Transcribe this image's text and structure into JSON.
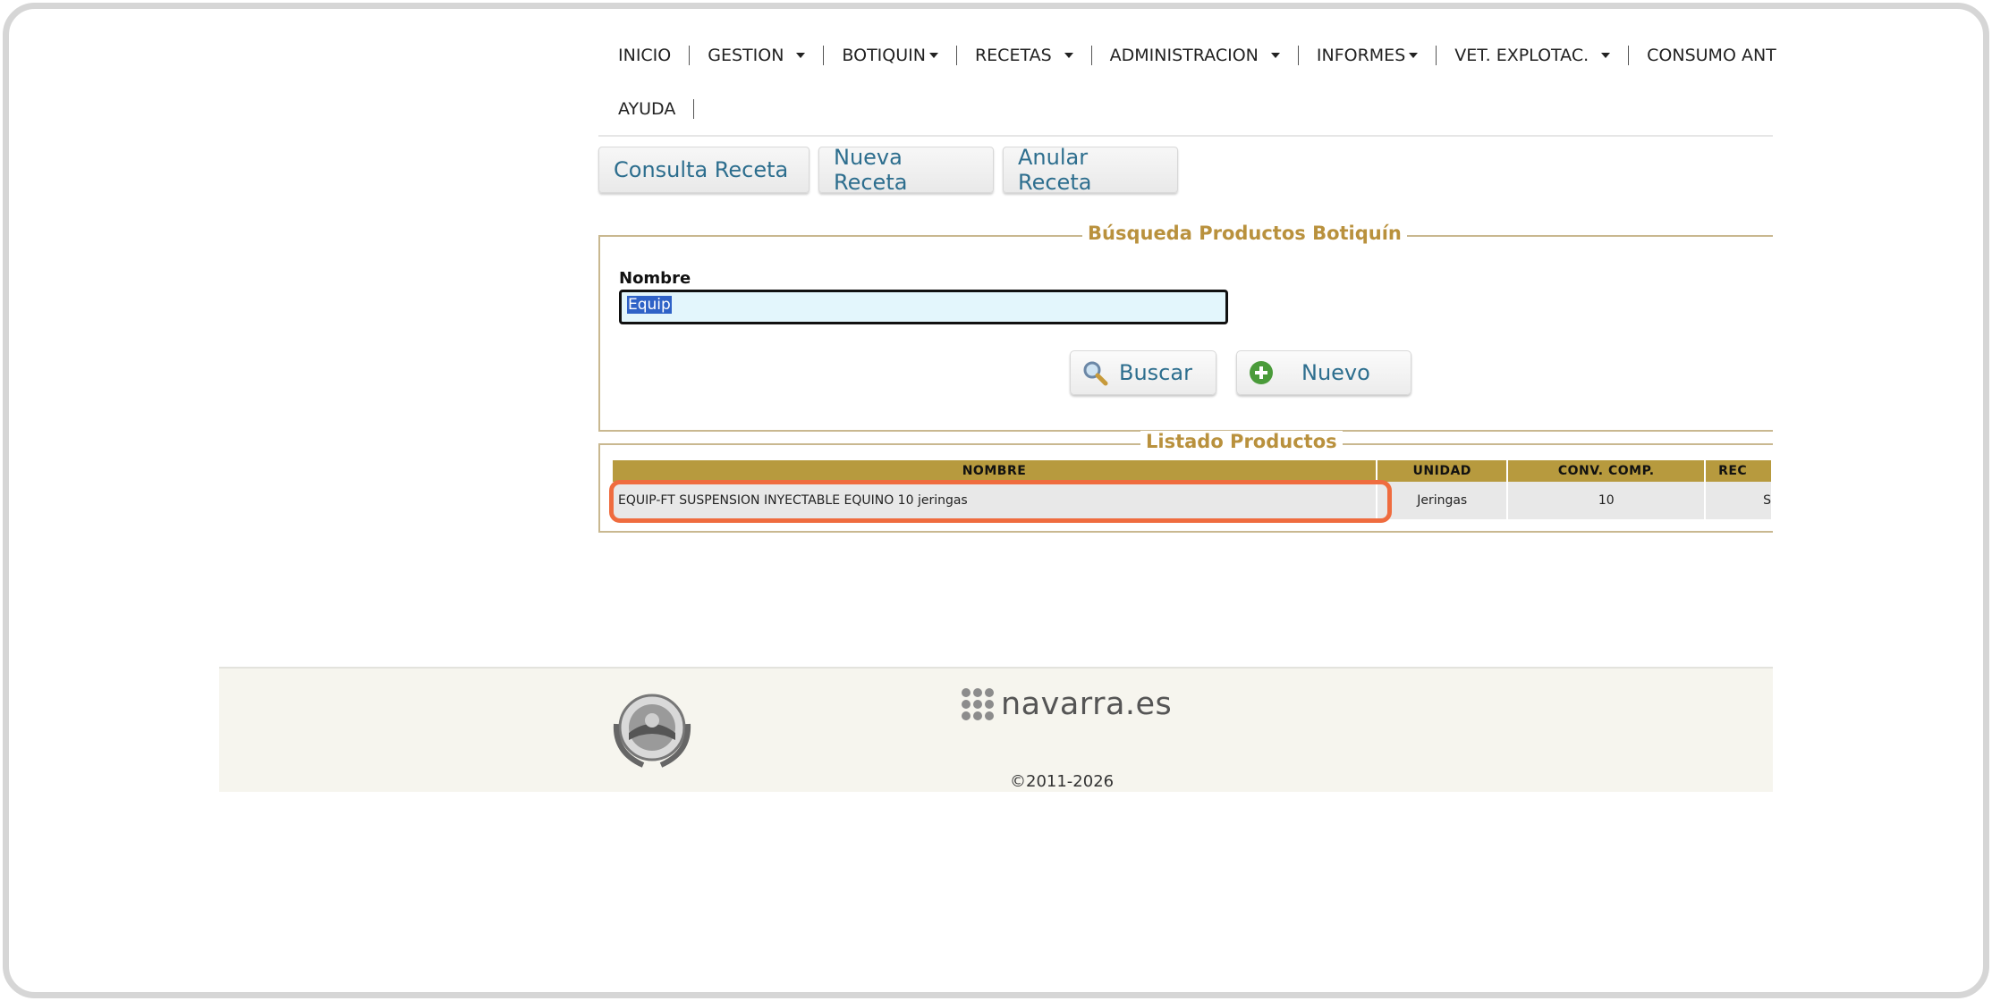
{
  "nav": {
    "items": [
      {
        "label": "INICIO"
      },
      {
        "label": "GESTION"
      },
      {
        "label": "BOTIQUIN"
      },
      {
        "label": "RECETAS"
      },
      {
        "label": "ADMINISTRACION"
      },
      {
        "label": "INFORMES"
      },
      {
        "label": "VET. EXPLOTAC."
      },
      {
        "label": "CONSUMO ANT"
      }
    ],
    "second_row": [
      {
        "label": "AYUDA"
      }
    ]
  },
  "tabs": {
    "consulta": "Consulta Receta",
    "nueva": "Nueva Receta",
    "anular": "Anular Receta"
  },
  "search": {
    "legend": "Búsqueda Productos Botiquín",
    "nombre_label": "Nombre",
    "nombre_value": "Equip",
    "buscar_label": "Buscar",
    "nuevo_label": "Nuevo"
  },
  "list": {
    "legend": "Listado Productos",
    "headers": [
      "NOMBRE",
      "UNIDAD",
      "CONV. COMP.",
      "REC"
    ],
    "rows": [
      {
        "nombre": "EQUIP-FT SUSPENSION INYECTABLE EQUINO 10 jeringas",
        "unidad": "Jeringas",
        "conv": "10",
        "rec": "S"
      }
    ]
  },
  "footer": {
    "brand": "navarra.es",
    "copyright": "©2011-2026"
  },
  "colors": {
    "legend": "#b9913d",
    "header_bg": "#b79a3e",
    "button_text": "#2d6e8e",
    "highlight": "#ef6c3f"
  }
}
